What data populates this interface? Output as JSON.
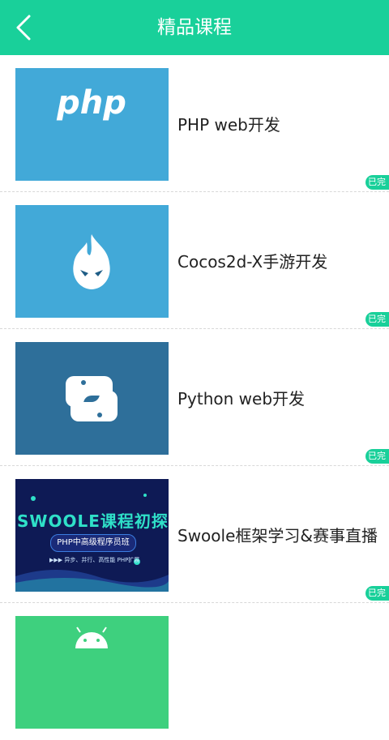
{
  "header": {
    "title": "精品课程",
    "back_icon": "back-arrow-icon"
  },
  "courses": [
    {
      "name": "PHP web开发",
      "thumb_text": "php",
      "thumb_color": "#42a9d8",
      "badge": "已完"
    },
    {
      "name": "Cocos2d-X手游开发",
      "thumb_color": "#42a9d8",
      "badge": "已完"
    },
    {
      "name": "Python web开发",
      "thumb_color": "#2e6f9a",
      "badge": "已完"
    },
    {
      "name": "Swoole框架学习&赛事直播",
      "thumb_color": "#0e1a55",
      "thumb_title": "SWOOLE课程初探",
      "thumb_sub": "PHP中高级程序员班",
      "thumb_desc": "▶▶▶ 异步、并行、高性能 PHP扩展",
      "badge": "已完"
    },
    {
      "name": "",
      "thumb_color": "#3ed07e",
      "badge": ""
    }
  ],
  "colors": {
    "accent": "#19d09a",
    "php_blue": "#42a9d8",
    "python_blue": "#2e6f9a"
  }
}
